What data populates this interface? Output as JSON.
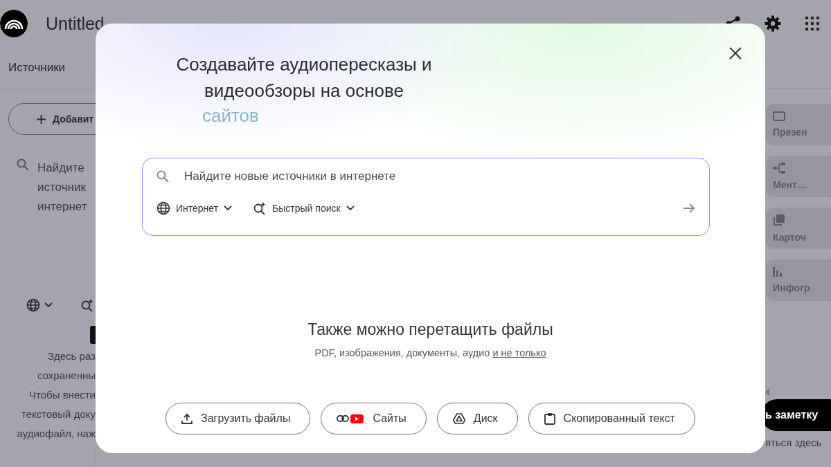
{
  "header": {
    "title": "Untitled"
  },
  "sources": {
    "title": "Источники",
    "add_button": "Добавит",
    "search_lines": [
      "Найдите",
      "источник",
      "интернет"
    ],
    "empty_lines": [
      "Здесь раз",
      "сохраненны",
      "Чтобы внести",
      "текстовый доку",
      "аудиофайл, наж"
    ]
  },
  "studio": {
    "cards": [
      {
        "label": "Презен",
        "kind": "slides"
      },
      {
        "label": "Мент…",
        "kind": "mindmap"
      },
      {
        "label": "Карточ",
        "kind": "cards"
      },
      {
        "label": "Инфогр",
        "kind": "chart"
      }
    ],
    "note_button": "ь заметку",
    "hint": "яться здесь"
  },
  "dialog": {
    "heading_lines": [
      "Создавайте аудиопересказы и",
      "видеообзоры на основе"
    ],
    "rotating_word": "сайтов",
    "search": {
      "placeholder": "Найдите новые источники в интернете",
      "chips": [
        {
          "label": "Интернет",
          "kind": "web"
        },
        {
          "label": "Быстрый поиск",
          "kind": "fast"
        }
      ]
    },
    "drop_title": "Также можно перетащить файлы",
    "drop_text": "PDF, изображения, документы, аудио",
    "drop_link": "и не только",
    "buttons": [
      {
        "label": "Загрузить файлы",
        "kind": "upload"
      },
      {
        "label": "Сайты",
        "kind": "sites"
      },
      {
        "label": "Диск",
        "kind": "drive"
      },
      {
        "label": "Скопированный текст",
        "kind": "paste"
      }
    ]
  }
}
